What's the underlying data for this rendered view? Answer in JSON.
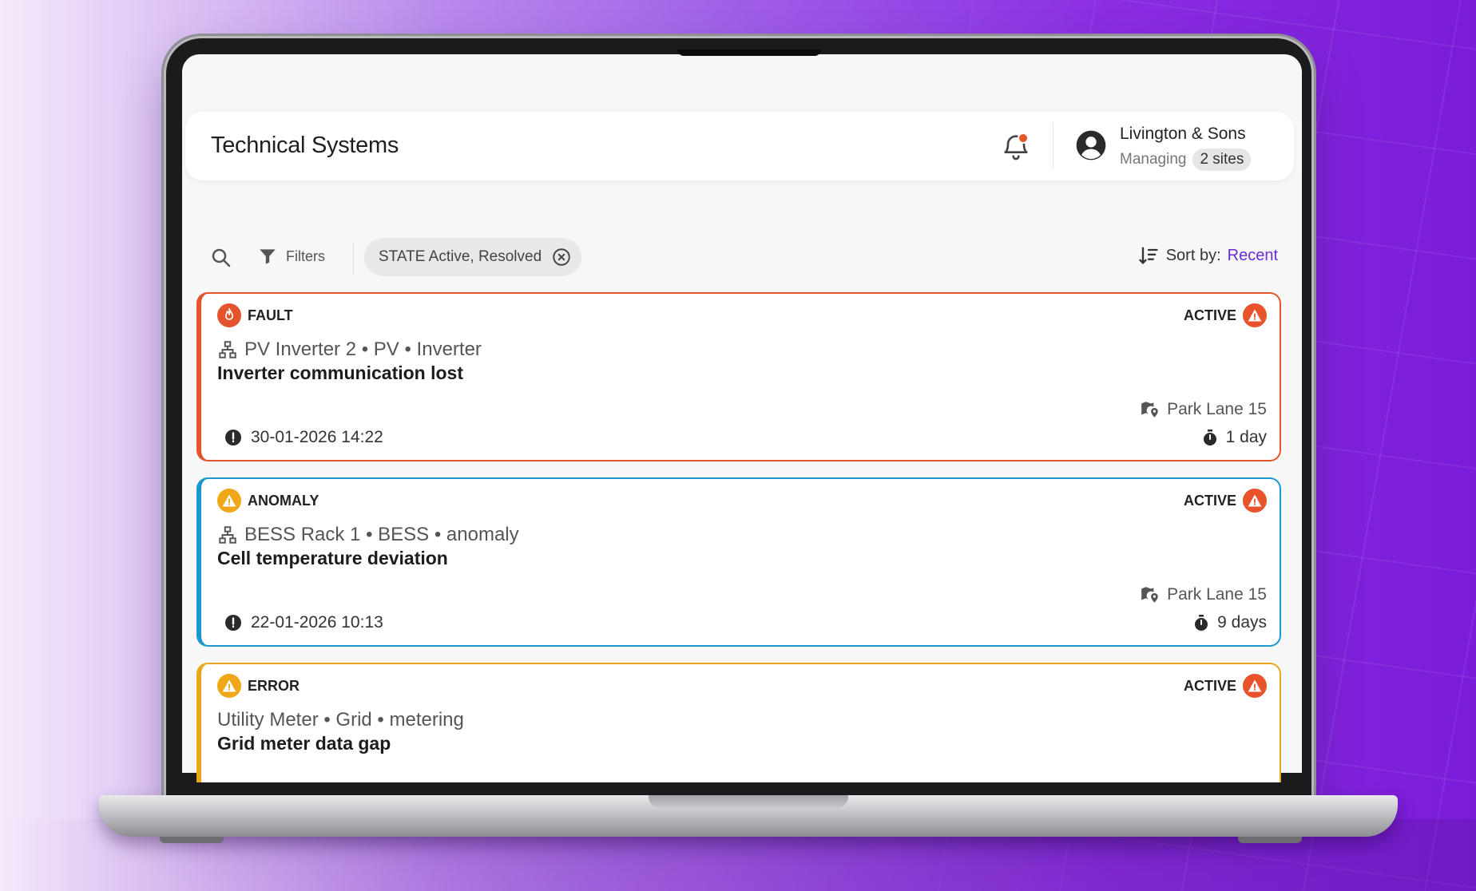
{
  "colors": {
    "fault": "#e4532b",
    "anomaly": "#1b96cf",
    "error": "#eaa71b",
    "active": "#e8532b",
    "accent": "#6b2bd6"
  },
  "header": {
    "title": "Technical Systems",
    "company": "Livington & Sons",
    "managing_label": "Managing",
    "sites_badge": "2 sites",
    "icons": [
      "bell-icon",
      "user-avatar-icon"
    ]
  },
  "toolbar": {
    "filters_label": "Filters",
    "state_chip": "STATE Active, Resolved",
    "sort_label": "Sort by:",
    "sort_value": "Recent",
    "icons": [
      "search-icon",
      "filter-icon",
      "close-circle-icon",
      "sort-icon"
    ]
  },
  "alerts": [
    {
      "type": "FAULT",
      "type_icon": "flame-icon",
      "state": "ACTIVE",
      "asset": "PV Inverter 2 • PV • Inverter",
      "title": "Inverter communication lost",
      "site": "Park Lane 15",
      "date": "30-01-2026 14:22",
      "duration": "1 day"
    },
    {
      "type": "ANOMALY",
      "type_icon": "warning-icon",
      "state": "ACTIVE",
      "asset": "BESS Rack 1 • BESS • anomaly",
      "title": "Cell temperature deviation",
      "site": "Park Lane 15",
      "date": "22-01-2026 10:13",
      "duration": "9 days"
    },
    {
      "type": "ERROR",
      "type_icon": "warning-icon",
      "state": "ACTIVE",
      "asset": "Utility Meter • Grid • metering",
      "title": "Grid meter data gap"
    }
  ]
}
